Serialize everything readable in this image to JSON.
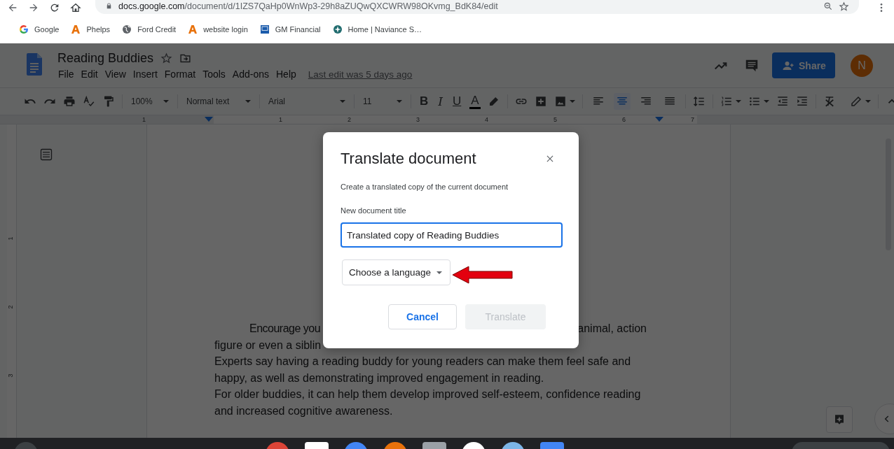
{
  "browser": {
    "url_host": "docs.google.com",
    "url_path": "/document/d/1IZS7QaHp0WnWp3-29h8aZUQwQXCWRW98OKvmg_BdK84/edit",
    "bookmarks": [
      {
        "label": "Google",
        "kind": "g-logo"
      },
      {
        "label": "Phelps",
        "kind": "a-logo"
      },
      {
        "label": "Ford Credit",
        "kind": "globe"
      },
      {
        "label": "website login",
        "kind": "a-logo"
      },
      {
        "label": "GM Financial",
        "kind": "square-logo"
      },
      {
        "label": "Home | Naviance S…",
        "kind": "compass"
      }
    ]
  },
  "docs_header": {
    "title": "Reading Buddies",
    "menu": [
      "File",
      "Edit",
      "View",
      "Insert",
      "Format",
      "Tools",
      "Add-ons",
      "Help"
    ],
    "last_edit": "Last edit was 5 days ago",
    "share": "Share",
    "avatar": "N"
  },
  "toolbar": {
    "zoom": "100%",
    "style": "Normal text",
    "font": "Arial",
    "size": "11",
    "format_buttons": [
      "B",
      "I",
      "U",
      "A"
    ],
    "align": [
      {
        "selected": false
      },
      {
        "selected": true
      },
      {
        "selected": false
      },
      {
        "selected": false
      }
    ]
  },
  "ruler": {
    "horizontal": [
      "1",
      "1",
      "2",
      "3",
      "4",
      "5",
      "6",
      "7"
    ],
    "vertical": [
      "1",
      "2",
      "3"
    ]
  },
  "document": {
    "first_line_left": "Encourage you",
    "first_line_right": "animal, action",
    "second_line": "figure or even a siblin",
    "paragraphs": [
      "Experts say having a reading buddy for young readers can make them feel safe and happy, as well as demonstrating improved engagement in reading.",
      "For older buddies, it can help them develop improved self-esteem, confidence reading and increased cognitive awareness."
    ]
  },
  "dialog": {
    "title": "Translate document",
    "description": "Create a translated copy of the current document",
    "field_label": "New document title",
    "field_value": "Translated copy of Reading Buddies",
    "language_dropdown": "Choose a language",
    "buttons": [
      {
        "label": "Cancel",
        "kind": "secondary",
        "disabled": false
      },
      {
        "label": "Translate",
        "kind": "primary",
        "disabled": true
      }
    ]
  }
}
